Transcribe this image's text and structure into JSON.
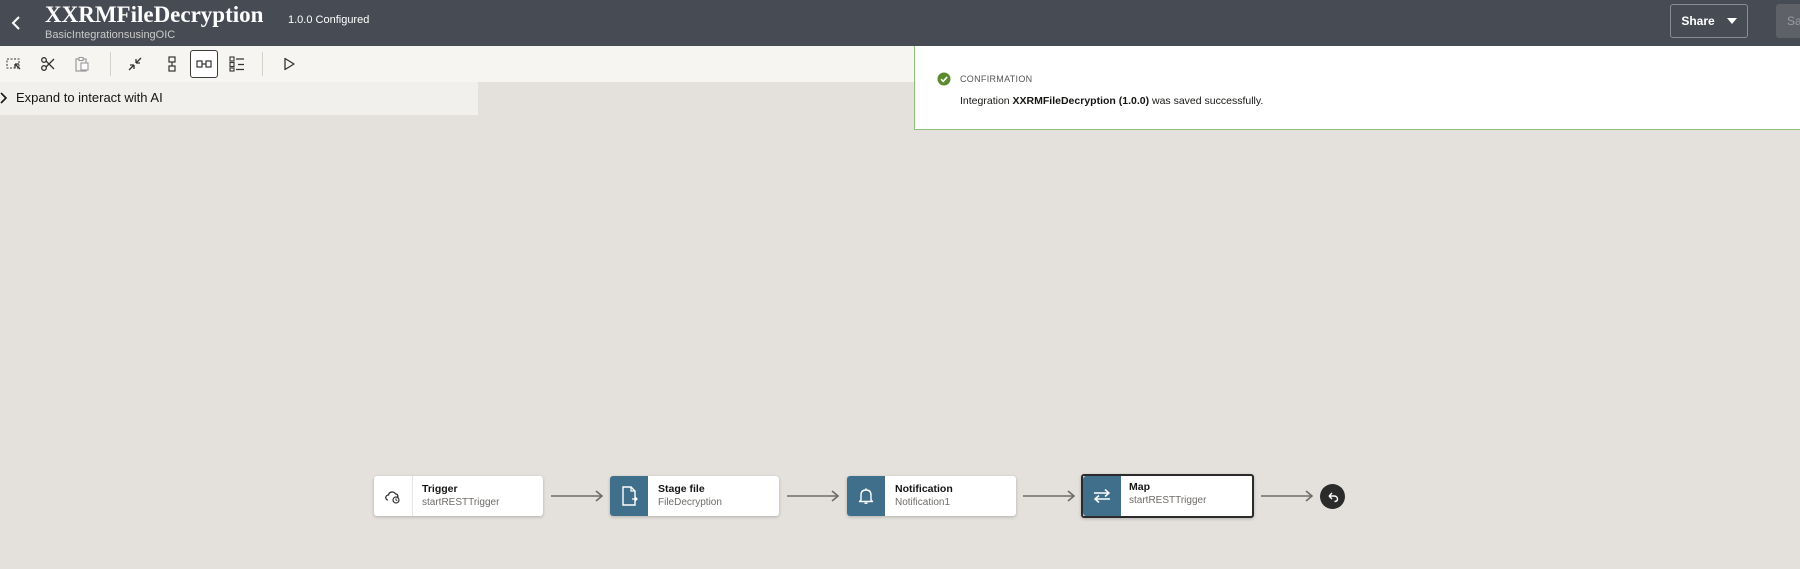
{
  "header": {
    "title": "XXRMFileDecryption",
    "subtitle": "BasicIntegrationsusingOIC",
    "version_status": "1.0.0 Configured",
    "share_label": "Share",
    "save_label": "Sa"
  },
  "toolbar": {
    "buttons": [
      {
        "icon": "select-icon"
      },
      {
        "icon": "cut-icon"
      },
      {
        "icon": "paste-icon"
      },
      {
        "icon": "collapse-icon"
      },
      {
        "icon": "vertical-layout-icon"
      },
      {
        "icon": "horizontal-layout-icon"
      },
      {
        "icon": "pseudo-view-icon"
      },
      {
        "icon": "run-icon"
      }
    ]
  },
  "ai_panel": {
    "label": "Expand to interact with AI"
  },
  "confirmation": {
    "heading": "CONFIRMATION",
    "prefix": "Integration",
    "name": "XXRMFileDecryption (1.0.0)",
    "suffix": "was saved successfully."
  },
  "flow": {
    "nodes": [
      {
        "label": "Trigger",
        "sub": "startRESTTrigger",
        "icon": "trigger-icon"
      },
      {
        "label": "Stage file",
        "sub": "FileDecryption",
        "icon": "stage-file-icon"
      },
      {
        "label": "Notification",
        "sub": "Notification1",
        "icon": "bell-icon"
      },
      {
        "label": "Map",
        "sub": "startRESTTrigger",
        "icon": "map-icon"
      }
    ],
    "end_icon": "return-icon"
  },
  "colors": {
    "header_bg": "#474b53",
    "canvas_bg": "#e4e1dc",
    "node_icon_bg": "#3f6f8a",
    "success": "#5c8a2e"
  }
}
